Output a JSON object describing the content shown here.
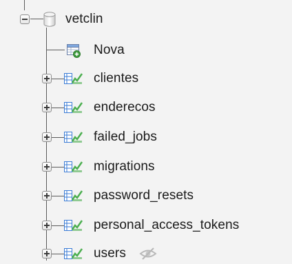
{
  "tree": {
    "database": {
      "name": "vetclin",
      "expanded": true
    },
    "new_item": {
      "label": "Nova"
    },
    "tables": [
      {
        "name": "clientes"
      },
      {
        "name": "enderecos"
      },
      {
        "name": "failed_jobs"
      },
      {
        "name": "migrations"
      },
      {
        "name": "password_resets"
      },
      {
        "name": "personal_access_tokens"
      },
      {
        "name": "users",
        "icon": "hidden-eye-icon"
      }
    ]
  },
  "icons": {
    "collapse": "minus-box-icon",
    "expand": "plus-box-icon",
    "database": "database-icon",
    "new": "new-table-icon",
    "table": "table-icon",
    "hidden": "eye-slash-icon"
  },
  "colors": {
    "background": "#f3f3f3",
    "tree_lines": "#5a5a5a",
    "text": "#1a1a1a",
    "table_icon_green": "#4caf50",
    "table_icon_blue": "#3a7bd5"
  }
}
